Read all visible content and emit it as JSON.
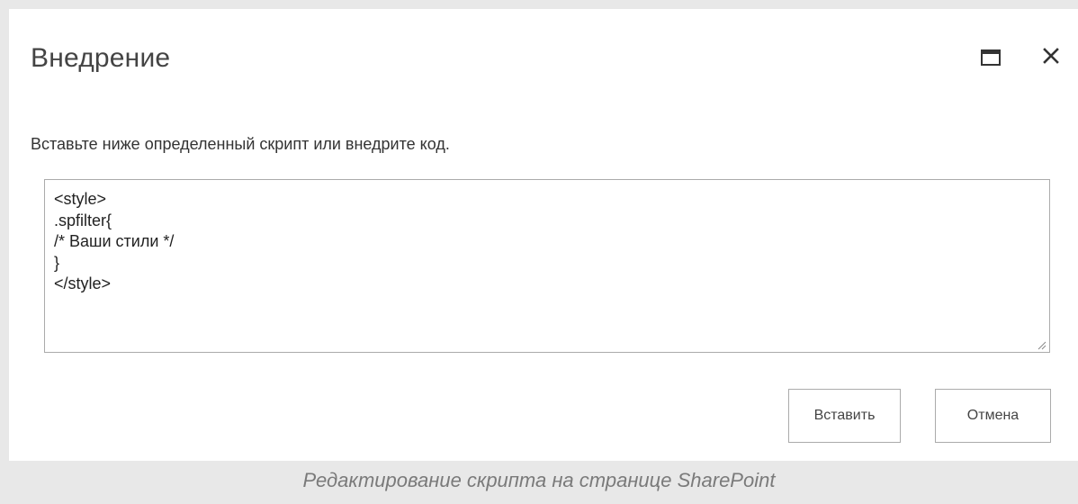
{
  "dialog": {
    "title": "Внедрение",
    "description": "Вставьте ниже определенный скрипт или внедрите код.",
    "code": "<style>\n.spfilter{\n/* Ваши стили */\n}\n</style>",
    "buttons": {
      "insert_label": "Вставить",
      "cancel_label": "Отмена"
    },
    "icons": {
      "maximize": "maximize-icon",
      "close": "close-icon"
    }
  },
  "caption": "Редактирование скрипта на странице SharePoint",
  "colors": {
    "background": "#e8e8e8",
    "dialog_bg": "#ffffff",
    "border": "#ababab",
    "title_text": "#444444",
    "caption_text": "#7a7a7a"
  }
}
